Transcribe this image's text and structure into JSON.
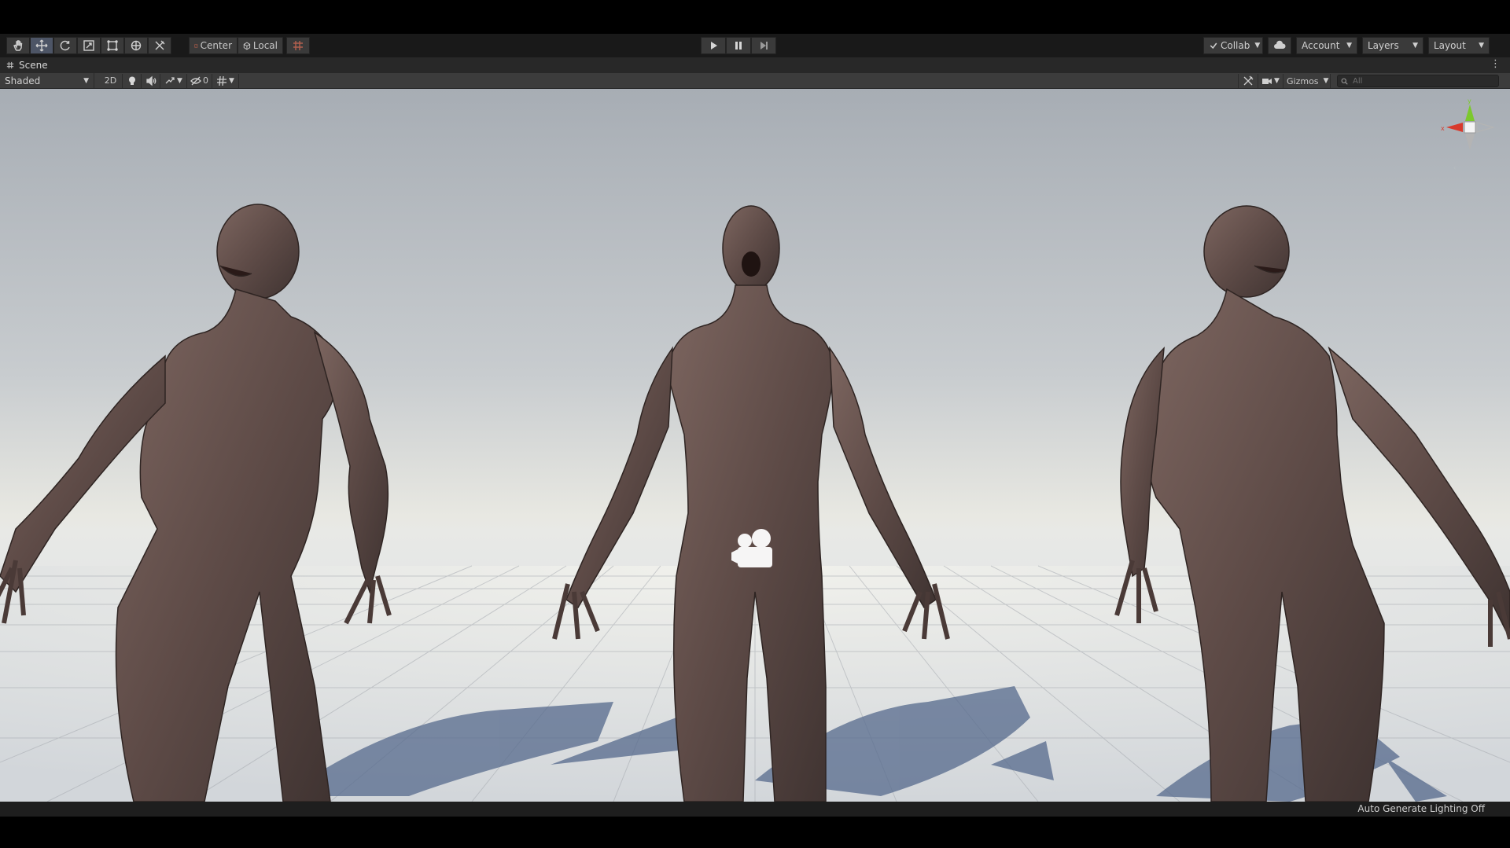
{
  "toolbar": {
    "tools": [
      {
        "icon": "hand-icon"
      },
      {
        "icon": "move-icon",
        "active": true
      },
      {
        "icon": "rotate-icon"
      },
      {
        "icon": "scale-icon"
      },
      {
        "icon": "rect-icon"
      },
      {
        "icon": "transform-icon"
      },
      {
        "icon": "custom-tool-icon"
      }
    ],
    "pivot_label": "Center",
    "space_label": "Local",
    "play_controls": [
      "play-icon",
      "pause-icon",
      "step-icon"
    ],
    "collab_label": "Collab",
    "account_label": "Account",
    "layers_label": "Layers",
    "layout_label": "Layout"
  },
  "scene_tab": {
    "label": "Scene"
  },
  "scene_bar": {
    "draw_mode": "Shaded",
    "mode_2d": "2D",
    "hidden_count": "0",
    "gizmos_label": "Gizmos",
    "search_placeholder": "All"
  },
  "viewport": {
    "orientation_axes": [
      "x",
      "y",
      "z"
    ],
    "characters": [
      "zombie-figure-left",
      "zombie-figure-center",
      "zombie-figure-right"
    ]
  },
  "status": {
    "lighting_text": "Auto Generate Lighting Off"
  },
  "colors": {
    "toolbar_bg": "#191919",
    "panel_bg": "#3c3c3c",
    "sky_top": "#a7adb4",
    "horizon": "#e8e8e2",
    "skin": "#6a5550",
    "shadow": "#5b6d8e",
    "axis_x": "#d83a2c",
    "axis_y": "#7cc82d",
    "axis_z": "#4a7ad6"
  }
}
